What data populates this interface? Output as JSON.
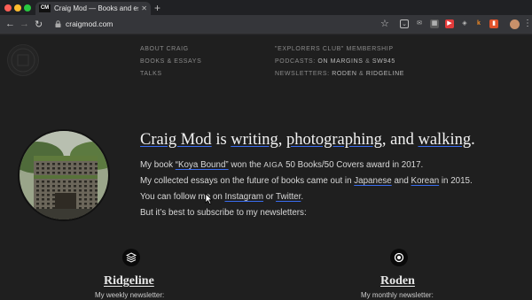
{
  "browser": {
    "tab_title": "Craig Mod — Books and essays",
    "tab_favicon": "CM",
    "url": "craigmod.com",
    "traffic_light_colors": [
      "#ff5f57",
      "#febc2e",
      "#28c840"
    ]
  },
  "site_nav": {
    "col1": [
      "ABOUT CRAIG",
      "BOOKS & ESSAYS",
      "TALKS"
    ],
    "col2": {
      "membership": "\"EXPLORERS CLUB\" MEMBERSHIP",
      "podcasts_label": "PODCASTS:",
      "podcast_a": "ON MARGINS",
      "podcast_amp": "&",
      "podcast_b": "SW945",
      "newsletters_label": "NEWSLETTERS:",
      "newsletter_a": "RODEN",
      "newsletter_amp": "&",
      "newsletter_b": "RIDGELINE"
    }
  },
  "hero": {
    "name": "Craig Mod",
    "mid1": " is ",
    "writing": "writing",
    "comma": ", ",
    "photographing": "photographing",
    "and": ", and ",
    "walking": "walking",
    "period": "."
  },
  "body": {
    "l1_a": "My book ",
    "l1_link": "“Koya Bound”",
    "l1_b": " won the ",
    "l1_aiga": "AIGA",
    "l1_c": " 50 Books/50 Covers award in 2017.",
    "l2_a": "My collected essays on the future of books came out in ",
    "l2_japanese": "Japanese",
    "l2_and": " and ",
    "l2_korean": "Korean",
    "l2_b": " in 2015.",
    "l3_a": "You can follow me on ",
    "l3_instagram": "Instagram",
    "l3_or": " or ",
    "l3_twitter": "Twitter",
    "l3_end": ".",
    "l4": "But it’s best to subscribe to my newsletters:"
  },
  "newsletters": [
    {
      "icon": "stack-icon",
      "title": "Ridgeline",
      "subtitle": "My weekly newsletter:"
    },
    {
      "icon": "circle-dot-icon",
      "title": "Roden",
      "subtitle": "My monthly newsletter:"
    }
  ]
}
